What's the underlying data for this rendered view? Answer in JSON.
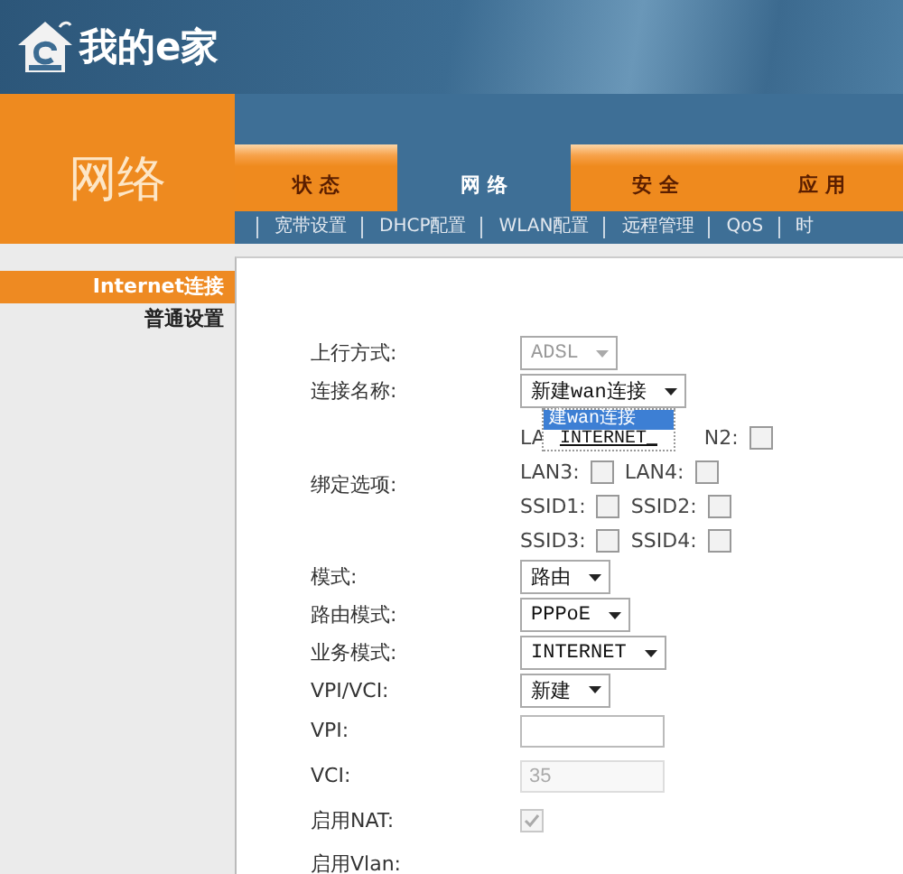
{
  "header": {
    "logo_text": "我的e家"
  },
  "section_title": "网络",
  "tabs": [
    {
      "label": "状 态",
      "selected": false
    },
    {
      "label": "网 络",
      "selected": true
    },
    {
      "label": "安 全",
      "selected": false
    },
    {
      "label": "应 用",
      "selected": false
    }
  ],
  "subnav": [
    {
      "label": "宽带设置"
    },
    {
      "label": "DHCP配置"
    },
    {
      "label": "WLAN配置"
    },
    {
      "label": "远程管理"
    },
    {
      "label": "QoS"
    },
    {
      "label": "时"
    }
  ],
  "sidebar": {
    "items": [
      {
        "label": "Internet连接",
        "selected": true
      },
      {
        "label": "普通设置",
        "selected": false
      }
    ]
  },
  "form": {
    "rows": [
      {
        "kind": "select",
        "label": "上行方式:",
        "value": "ADSL",
        "disabled": true
      },
      {
        "kind": "select",
        "label": "连接名称:",
        "value": "新建wan连接",
        "disabled": false,
        "expanded": true,
        "options": [
          {
            "label": "建wan连接",
            "selected": true
          },
          {
            "label": "INTERNET_",
            "selected": false
          }
        ]
      },
      {
        "kind": "checkboxes",
        "label": "绑定选项:",
        "lines": [
          {
            "items": [
              {
                "label": "LA"
              },
              {
                "label": "N2:",
                "checked": false
              }
            ]
          },
          {
            "items": [
              {
                "label": "LAN3:",
                "checked": false
              },
              {
                "label": "LAN4:",
                "checked": false
              }
            ]
          },
          {
            "items": [
              {
                "label": "SSID1:",
                "checked": false
              },
              {
                "label": "SSID2:",
                "checked": false
              }
            ]
          },
          {
            "items": [
              {
                "label": "SSID3:",
                "checked": false
              },
              {
                "label": "SSID4:",
                "checked": false
              }
            ]
          }
        ]
      },
      {
        "kind": "select",
        "label": "模式:",
        "value": "路由",
        "disabled": false
      },
      {
        "kind": "select",
        "label": "路由模式:",
        "value": "PPPoE",
        "disabled": false
      },
      {
        "kind": "select",
        "label": "业务模式:",
        "value": "INTERNET",
        "disabled": false
      },
      {
        "kind": "select",
        "label": "VPI/VCI:",
        "value": "新建",
        "disabled": false
      },
      {
        "kind": "text",
        "label": "VPI:",
        "disabled": false
      },
      {
        "kind": "text",
        "label": "VCI:",
        "value": "35",
        "disabled": true
      },
      {
        "kind": "checkbox",
        "label": "启用NAT:",
        "checked": true,
        "disabled": true
      },
      {
        "kind": "none",
        "label": "启用Vlan:"
      }
    ]
  }
}
